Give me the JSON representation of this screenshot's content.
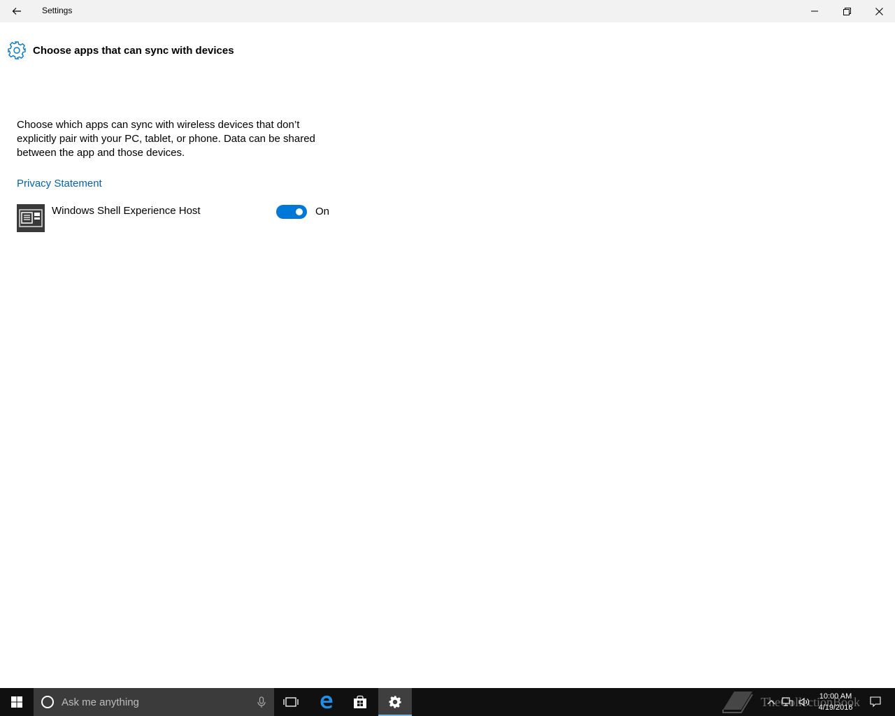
{
  "titlebar": {
    "title": "Settings"
  },
  "header": {
    "title": "Choose apps that can sync with devices"
  },
  "content": {
    "description": "Choose which apps can sync with wireless devices that don’t explicitly pair with your PC, tablet, or phone. Data can be shared between the app and those devices.",
    "privacy_link": "Privacy Statement",
    "apps": [
      {
        "name": "Windows Shell Experience Host",
        "toggle_state": "On",
        "enabled": true
      }
    ]
  },
  "taskbar": {
    "search_placeholder": "Ask me anything",
    "time": "10:00 AM",
    "date": "4/19/2016",
    "watermark": "TheCollectionBook"
  },
  "colors": {
    "accent": "#0078d7",
    "link": "#0063b1",
    "taskbar": "#101010"
  },
  "icons": [
    "back-arrow-icon",
    "minimize-icon",
    "maximize-icon",
    "close-icon",
    "gear-icon",
    "app-window-icon",
    "windows-logo-icon",
    "cortana-icon",
    "microphone-icon",
    "task-view-icon",
    "edge-icon",
    "store-icon",
    "settings-gear-icon",
    "chevron-up-icon",
    "network-icon",
    "volume-icon",
    "action-center-icon"
  ]
}
